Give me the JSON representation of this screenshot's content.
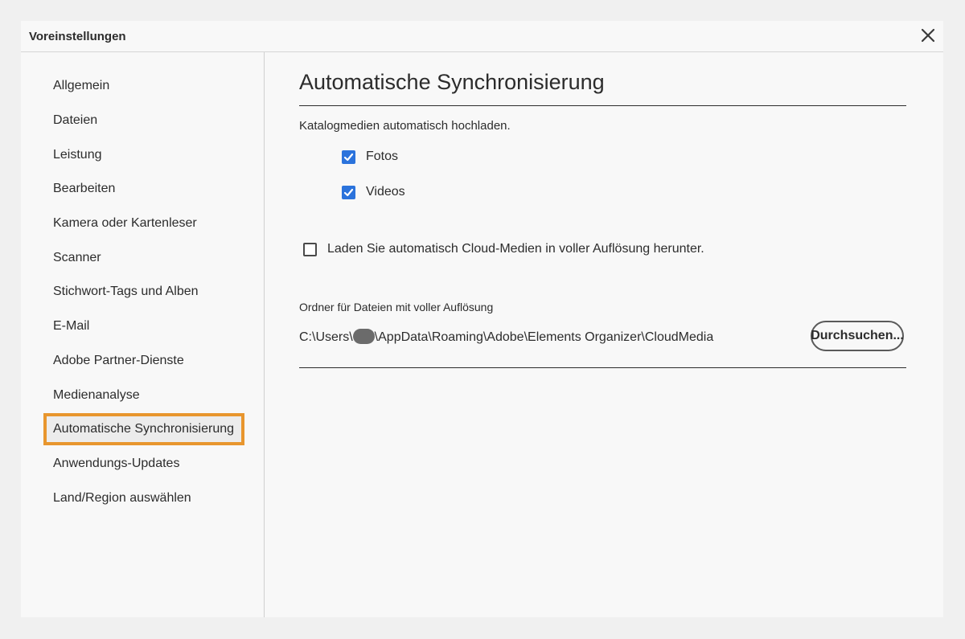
{
  "window": {
    "title": "Voreinstellungen",
    "close_icon": "close-icon"
  },
  "sidebar": {
    "items": [
      {
        "label": "Allgemein"
      },
      {
        "label": "Dateien"
      },
      {
        "label": "Leistung"
      },
      {
        "label": "Bearbeiten"
      },
      {
        "label": "Kamera oder Kartenleser"
      },
      {
        "label": "Scanner"
      },
      {
        "label": "Stichwort-Tags und Alben"
      },
      {
        "label": "E-Mail"
      },
      {
        "label": "Adobe Partner-Dienste"
      },
      {
        "label": "Medienanalyse"
      },
      {
        "label": "Automatische Synchronisierung",
        "selected": true
      },
      {
        "label": "Anwendungs-Updates"
      },
      {
        "label": "Land/Region auswählen"
      }
    ],
    "highlight_color": "#e8962e"
  },
  "main": {
    "heading": "Automatische Synchronisierung",
    "upload_intro": "Katalogmedien automatisch hochladen.",
    "photos": {
      "label": "Fotos",
      "checked": true
    },
    "videos": {
      "label": "Videos",
      "checked": true
    },
    "download_full_res": {
      "label": "Laden Sie automatisch Cloud-Medien in voller Auflösung herunter.",
      "checked": false
    },
    "folder_label": "Ordner für Dateien mit voller Auflösung",
    "path_prefix": "C:\\Users\\",
    "path_suffix": "\\AppData\\Roaming\\Adobe\\Elements Organizer\\CloudMedia",
    "browse_label": "Durchsuchen...",
    "checkbox_color": "#2b73dc"
  }
}
